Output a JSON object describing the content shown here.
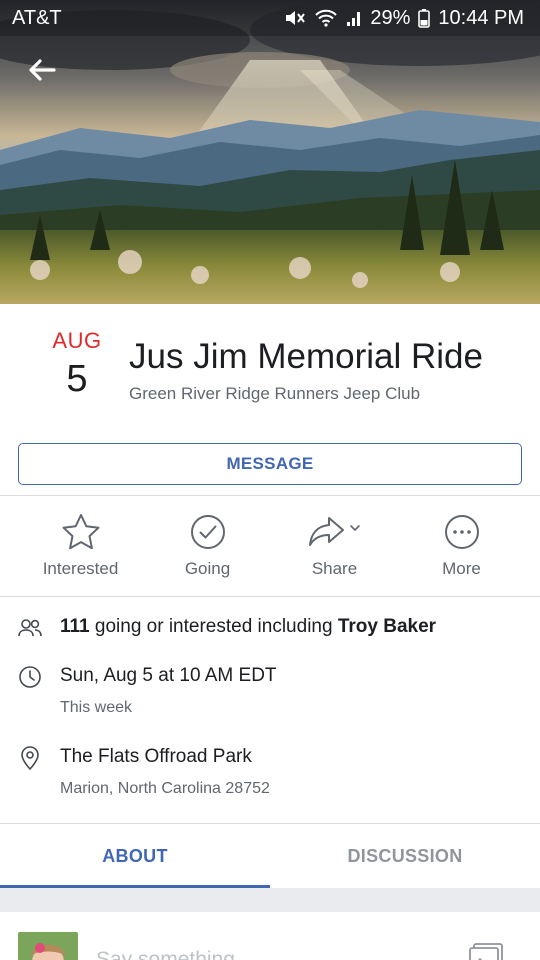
{
  "status_bar": {
    "carrier": "AT&T",
    "battery": "29%",
    "time": "10:44 PM",
    "icons": [
      "mute-icon",
      "wifi-icon",
      "signal-icon",
      "battery-icon"
    ]
  },
  "cover": {
    "description_icon": "mountain-landscape-photo"
  },
  "event": {
    "month": "AUG",
    "day": "5",
    "title": "Jus Jim Memorial Ride",
    "host": "Green River Ridge Runners Jeep Club"
  },
  "message_button": {
    "label": "MESSAGE"
  },
  "actions": [
    {
      "label": "Interested",
      "icon": "star-icon"
    },
    {
      "label": "Going",
      "icon": "check-circle-icon"
    },
    {
      "label": "Share",
      "icon": "share-icon"
    },
    {
      "label": "More",
      "icon": "more-icon"
    }
  ],
  "guests": {
    "count": "111",
    "text": "going or interested including",
    "friend": "Troy Baker"
  },
  "time": {
    "main": "Sun, Aug 5 at 10 AM EDT",
    "sub": "This week"
  },
  "location": {
    "main": "The Flats Offroad Park",
    "sub": "Marion, North Carolina 28752"
  },
  "tabs": [
    {
      "label": "ABOUT",
      "active": true
    },
    {
      "label": "DISCUSSION",
      "active": false
    }
  ],
  "composer": {
    "placeholder": "Say something..."
  },
  "colors": {
    "accent": "#4267b2",
    "month_red": "#e02a2a",
    "secondary_text": "#606770"
  }
}
